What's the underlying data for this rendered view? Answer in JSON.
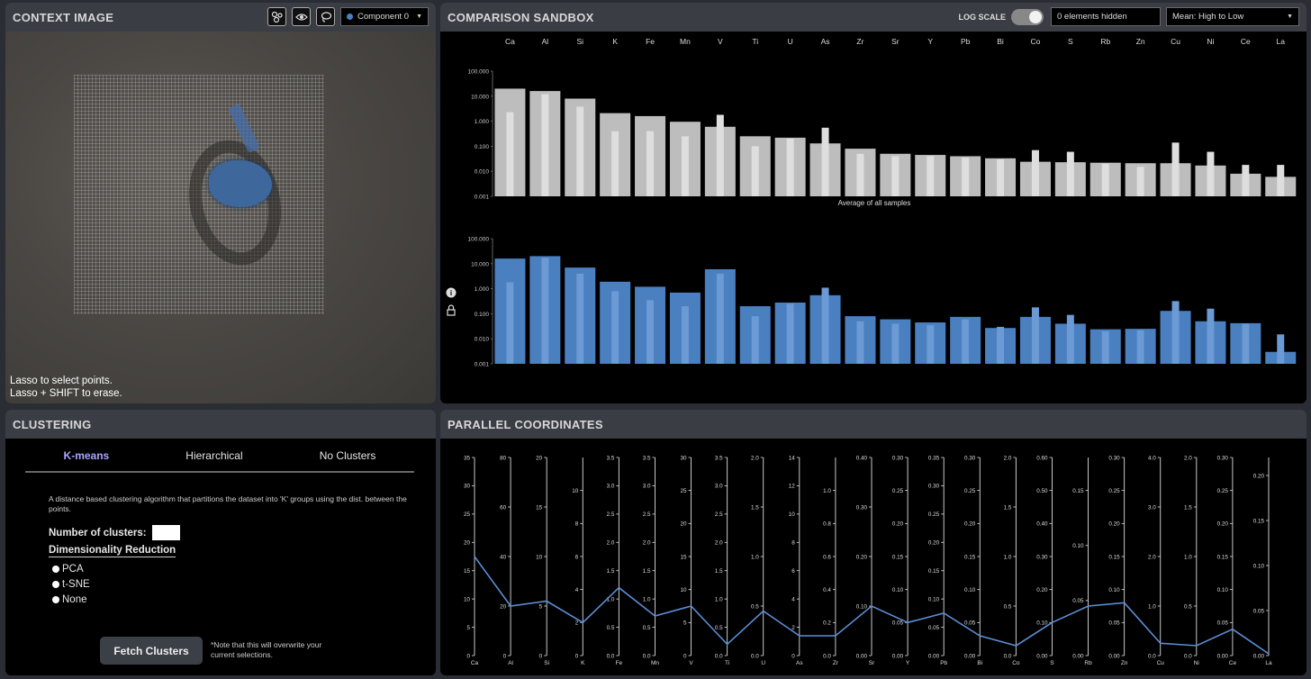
{
  "context": {
    "title": "CONTEXT IMAGE",
    "component_select": "Component 0",
    "lasso_help_1": "Lasso to select points.",
    "lasso_help_2": "Lasso + SHIFT to erase.",
    "icons": [
      "scatter-toggle-icon",
      "eye-icon",
      "lasso-icon"
    ]
  },
  "comparison": {
    "title": "COMPARISON SANDBOX",
    "log_scale_label": "LOG SCALE",
    "log_scale_on": true,
    "hidden_label": "0 elements hidden",
    "sort_select": "Mean: High to Low",
    "top_chart_caption": "Average of all samples"
  },
  "clustering": {
    "title": "CLUSTERING",
    "tabs": [
      "K-means",
      "Hierarchical",
      "No Clusters"
    ],
    "active_tab": 0,
    "description": "A distance based clustering algorithm that partitions the dataset into 'K' groups using the dist. between the points.",
    "num_clusters_label": "Number of clusters:",
    "num_clusters_value": "",
    "dimred_label": "Dimensionality Reduction",
    "dimred_options": [
      "PCA",
      "t-SNE",
      "None"
    ],
    "fetch_button": "Fetch Clusters",
    "fetch_note": "*Note that this will overwrite your current selections."
  },
  "parallel": {
    "title": "PARALLEL COORDINATES"
  },
  "chart_data": [
    {
      "type": "bar",
      "name": "avg-all-samples",
      "categories": [
        "Ca",
        "Al",
        "Si",
        "K",
        "Fe",
        "Mn",
        "V",
        "Ti",
        "U",
        "As",
        "Zr",
        "Sr",
        "Y",
        "Pb",
        "Bi",
        "Co",
        "S",
        "Rb",
        "Zn",
        "Cu",
        "Ni",
        "Ce",
        "La"
      ],
      "yscale": "log",
      "ylim": [
        0.001,
        100
      ],
      "yticks": [
        "100.000",
        "10.000",
        "1.000",
        "0.100",
        "0.010",
        "0.001"
      ],
      "xlabel": "Average of all samples",
      "color": "#bdbdbd",
      "series": [
        {
          "values": [
            20,
            16,
            8,
            2.1,
            1.6,
            0.95,
            0.6,
            0.25,
            0.22,
            0.13,
            0.08,
            0.05,
            0.045,
            0.04,
            0.033,
            0.024,
            0.023,
            0.022,
            0.021,
            0.021,
            0.017,
            0.008,
            0.006
          ]
        },
        {
          "values": [
            2.3,
            12,
            3.8,
            0.4,
            0.4,
            0.25,
            1.8,
            0.1,
            0.2,
            0.55,
            0.05,
            0.04,
            0.04,
            0.035,
            0.03,
            0.07,
            0.06,
            0.02,
            0.015,
            0.14,
            0.06,
            0.018,
            0.018
          ]
        }
      ]
    },
    {
      "type": "bar",
      "name": "selection",
      "categories": [
        "Ca",
        "Al",
        "Si",
        "K",
        "Fe",
        "Mn",
        "V",
        "Ti",
        "U",
        "As",
        "Zr",
        "Sr",
        "Y",
        "Pb",
        "Bi",
        "Co",
        "S",
        "Rb",
        "Zn",
        "Cu",
        "Ni",
        "Ce",
        "La"
      ],
      "yscale": "log",
      "ylim": [
        0.001,
        100
      ],
      "yticks": [
        "100.000",
        "10.000",
        "1.000",
        "0.100",
        "0.010",
        "0.001"
      ],
      "color": "#4a7fc0",
      "series": [
        {
          "values": [
            16,
            20,
            7,
            1.9,
            1.2,
            0.7,
            6,
            0.2,
            0.28,
            0.55,
            0.08,
            0.06,
            0.045,
            0.075,
            0.027,
            0.075,
            0.04,
            0.024,
            0.025,
            0.13,
            0.05,
            0.042,
            0.003
          ]
        },
        {
          "values": [
            1.8,
            17,
            4,
            0.8,
            0.35,
            0.2,
            4,
            0.08,
            0.25,
            1.1,
            0.05,
            0.04,
            0.035,
            0.06,
            0.03,
            0.18,
            0.09,
            0.02,
            0.022,
            0.32,
            0.16,
            0.04,
            0.015
          ]
        }
      ]
    },
    {
      "type": "line",
      "name": "parallel-coordinates",
      "axes": [
        {
          "label": "Ca",
          "max": 35,
          "ticks": [
            0,
            5,
            10,
            15,
            20,
            25,
            30,
            35
          ],
          "value": 17.5
        },
        {
          "label": "Al",
          "max": 80,
          "ticks": [
            0,
            20,
            40,
            60,
            80
          ],
          "value": 20
        },
        {
          "label": "Si",
          "max": 20,
          "ticks": [
            0,
            5,
            10,
            15,
            20
          ],
          "value": 5.5
        },
        {
          "label": "K",
          "max": 12,
          "ticks": [
            0,
            2,
            4,
            6,
            8,
            10
          ],
          "value": 2
        },
        {
          "label": "Fe",
          "max": 3.5,
          "ticks": [
            0,
            0.5,
            1.0,
            1.5,
            2.0,
            2.5,
            3.0,
            3.5
          ],
          "value": 1.2
        },
        {
          "label": "Mn",
          "max": 3.5,
          "ticks": [
            0,
            0.5,
            1.0,
            1.5,
            2.0,
            2.5,
            3.0,
            3.5
          ],
          "value": 0.7
        },
        {
          "label": "V",
          "max": 30,
          "ticks": [
            0,
            5,
            10,
            15,
            20,
            25,
            30
          ],
          "value": 7.5
        },
        {
          "label": "Ti",
          "max": 3.5,
          "ticks": [
            0,
            0.5,
            1.0,
            1.5,
            2.0,
            2.5,
            3.0,
            3.5
          ],
          "value": 0.2
        },
        {
          "label": "U",
          "max": 2.0,
          "ticks": [
            0,
            0.5,
            1.0,
            1.5,
            2.0
          ],
          "value": 0.45
        },
        {
          "label": "As",
          "max": 14,
          "ticks": [
            0,
            2,
            4,
            6,
            8,
            10,
            12,
            14
          ],
          "value": 1.4
        },
        {
          "label": "Zr",
          "max": 1.2,
          "ticks": [
            0,
            0.2,
            0.4,
            0.6,
            0.8,
            1.0
          ],
          "value": 0.12
        },
        {
          "label": "Sr",
          "max": 0.4,
          "ticks": [
            0,
            0.1,
            0.2,
            0.3,
            0.4
          ],
          "value": 0.1
        },
        {
          "label": "Y",
          "max": 0.3,
          "ticks": [
            0,
            0.05,
            0.1,
            0.15,
            0.2,
            0.25,
            0.3
          ],
          "value": 0.05
        },
        {
          "label": "Pb",
          "max": 0.35,
          "ticks": [
            0,
            0.05,
            0.1,
            0.15,
            0.2,
            0.25,
            0.3,
            0.35
          ],
          "value": 0.075
        },
        {
          "label": "Bi",
          "max": 0.3,
          "ticks": [
            0,
            0.05,
            0.1,
            0.15,
            0.2,
            0.25,
            0.3
          ],
          "value": 0.03
        },
        {
          "label": "Co",
          "max": 2.0,
          "ticks": [
            0,
            0.5,
            1.0,
            1.5,
            2.0
          ],
          "value": 0.1
        },
        {
          "label": "S",
          "max": 0.6,
          "ticks": [
            0,
            0.1,
            0.2,
            0.3,
            0.4,
            0.5,
            0.6
          ],
          "value": 0.1
        },
        {
          "label": "Rb",
          "max": 0.18,
          "ticks": [
            0,
            0.05,
            0.1,
            0.15
          ],
          "value": 0.045
        },
        {
          "label": "Zn",
          "max": 0.3,
          "ticks": [
            0,
            0.05,
            0.1,
            0.15,
            0.2,
            0.25,
            0.3
          ],
          "value": 0.08
        },
        {
          "label": "Cu",
          "max": 4,
          "ticks": [
            0,
            1,
            2,
            3,
            4
          ],
          "value": 0.25
        },
        {
          "label": "Ni",
          "max": 2.0,
          "ticks": [
            0,
            0.5,
            1.0,
            1.5,
            2.0
          ],
          "value": 0.1
        },
        {
          "label": "Ce",
          "max": 0.3,
          "ticks": [
            0,
            0.05,
            0.1,
            0.15,
            0.2,
            0.25,
            0.3
          ],
          "value": 0.04
        },
        {
          "label": "La",
          "max": 0.22,
          "ticks": [
            0,
            0.05,
            0.1,
            0.15,
            0.2
          ],
          "value": 0.002
        }
      ]
    }
  ]
}
